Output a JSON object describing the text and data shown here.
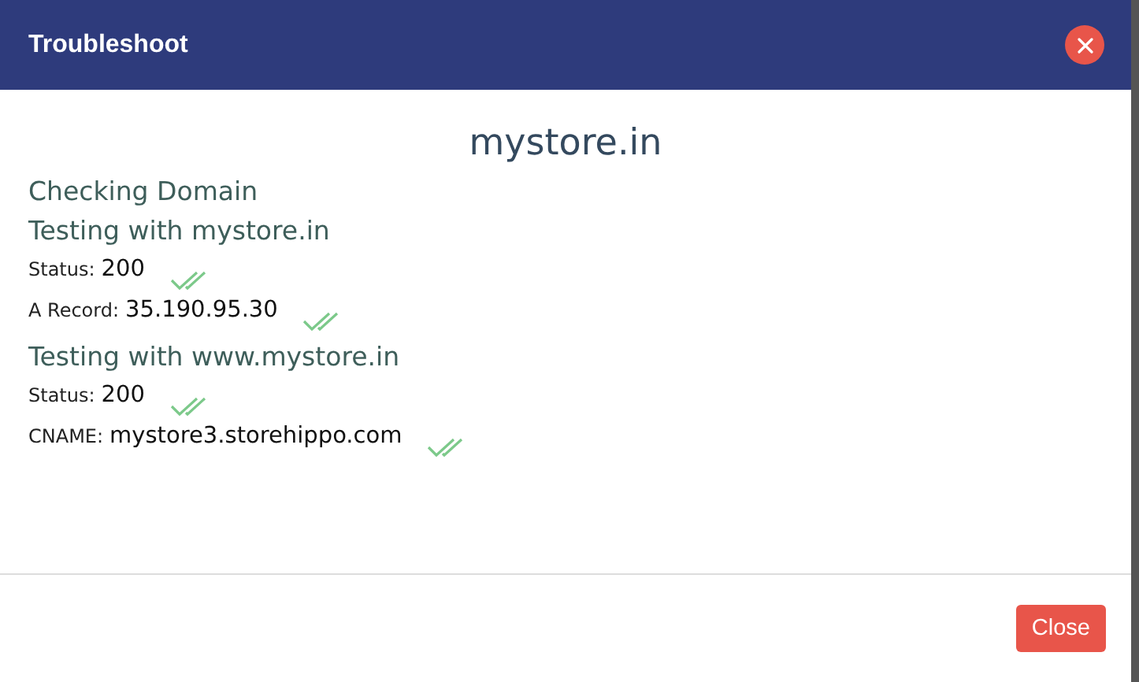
{
  "dialog": {
    "title": "Troubleshoot"
  },
  "domain": "mystore.in",
  "heading": "Checking Domain",
  "tests": [
    {
      "title": "Testing with mystore.in",
      "checks": [
        {
          "label": "Status:",
          "value": "200",
          "passed": true
        },
        {
          "label": "A Record:",
          "value": "35.190.95.30",
          "passed": true
        }
      ]
    },
    {
      "title": "Testing with www.mystore.in",
      "checks": [
        {
          "label": "Status:",
          "value": "200",
          "passed": true
        },
        {
          "label": "CNAME:",
          "value": "mystore3.storehippo.com",
          "passed": true
        }
      ]
    }
  ],
  "footer": {
    "button": "Close"
  }
}
